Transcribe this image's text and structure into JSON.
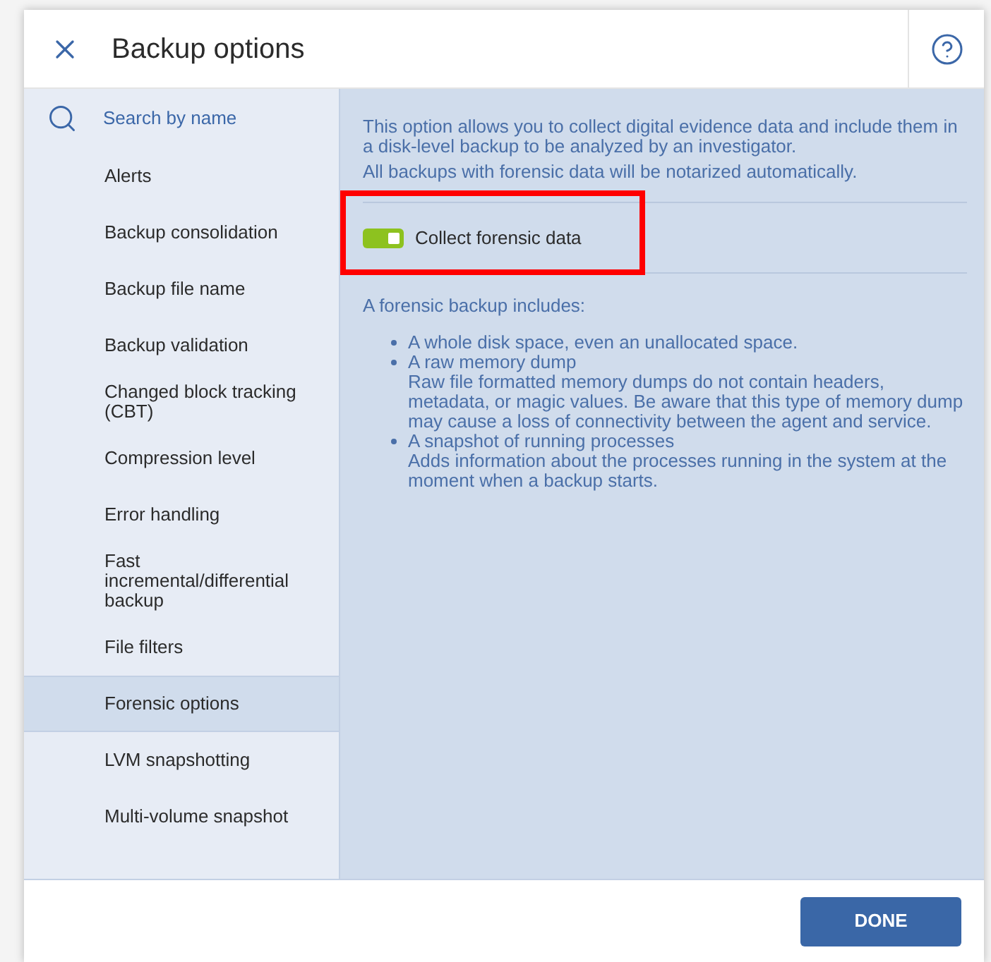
{
  "dialog": {
    "title": "Backup options"
  },
  "search": {
    "placeholder": "Search by name"
  },
  "sidebar": {
    "items": [
      {
        "label": "Alerts",
        "selected": false
      },
      {
        "label": "Backup consolidation",
        "selected": false
      },
      {
        "label": "Backup file name",
        "selected": false
      },
      {
        "label": "Backup validation",
        "selected": false
      },
      {
        "label": "Changed block tracking (CBT)",
        "selected": false
      },
      {
        "label": "Compression level",
        "selected": false
      },
      {
        "label": "Error handling",
        "selected": false
      },
      {
        "label": "Fast incremental/differential backup",
        "selected": false
      },
      {
        "label": "File filters",
        "selected": false
      },
      {
        "label": "Forensic options",
        "selected": true
      },
      {
        "label": "LVM snapshotting",
        "selected": false
      },
      {
        "label": "Multi-volume snapshot",
        "selected": false
      }
    ]
  },
  "content": {
    "intro": [
      "This option allows you to collect digital evidence data and include them in a disk-level backup to be analyzed by an investigator.",
      "All backups with forensic data will be notarized automatically."
    ],
    "toggle": {
      "label": "Collect forensic data",
      "on": true,
      "highlighted": true
    },
    "includes_heading": "A forensic backup includes:",
    "includes": [
      {
        "title": "A whole disk space, even an unallocated space."
      },
      {
        "title": "A raw memory dump",
        "detail": "Raw file formatted memory dumps do not contain headers, metadata, or magic values. Be aware that this type of memory dump may cause a loss of connectivity between the agent and service."
      },
      {
        "title": "A snapshot of running processes",
        "detail": "Adds information about the processes running in the system at the moment when a backup starts."
      }
    ]
  },
  "footer": {
    "done_button": "DONE"
  }
}
